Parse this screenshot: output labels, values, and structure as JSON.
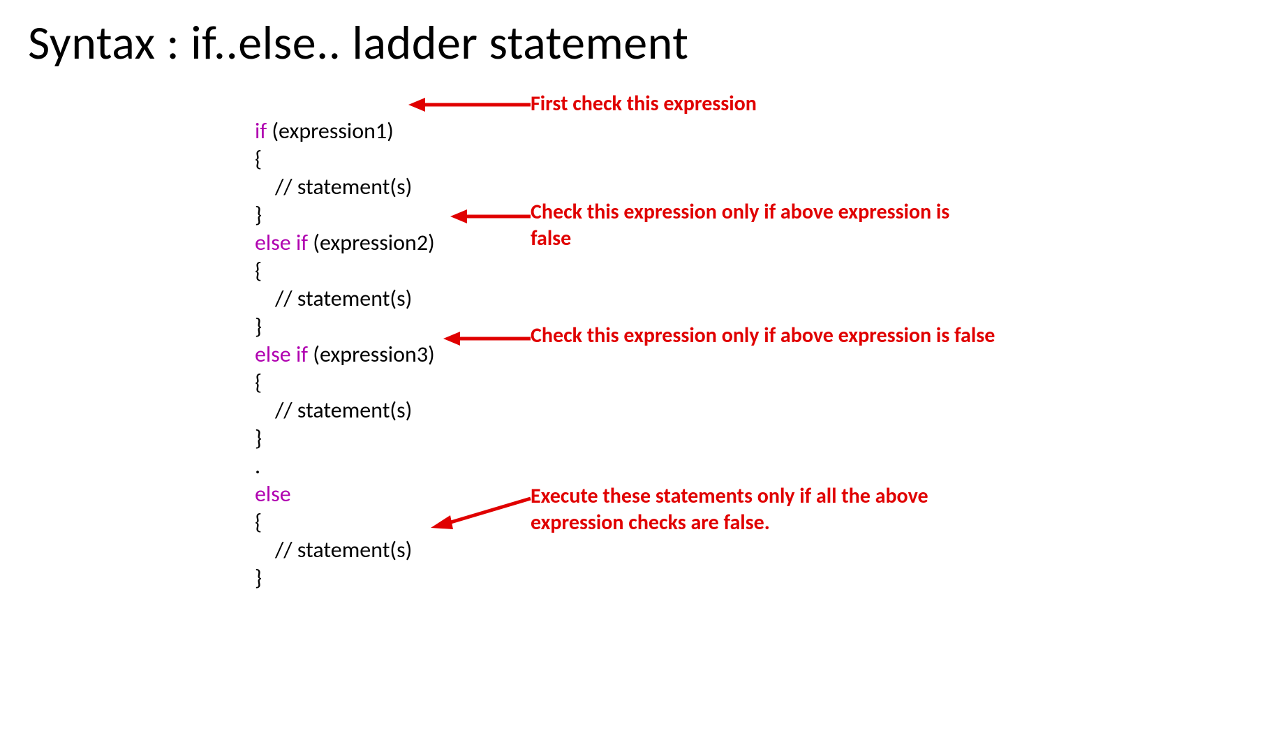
{
  "title": "Syntax : if..else.. ladder statement",
  "code": {
    "if_kw": "if ",
    "if_expr": "(expression1)",
    "open_brace": "{",
    "stmt_indent": "    // statement(s)",
    "close_brace": "}",
    "elseif_kw": "else if ",
    "elseif1_expr": "(expression2)",
    "elseif2_expr": "(expression3)",
    "dot": ".",
    "else_kw": "else"
  },
  "annotations": {
    "a1": "First check this expression",
    "a2": "Check this expression only if above expression is false",
    "a3": "Check this expression only if above expression is false",
    "a4": "Execute these statements only if all the above expression checks are false."
  }
}
